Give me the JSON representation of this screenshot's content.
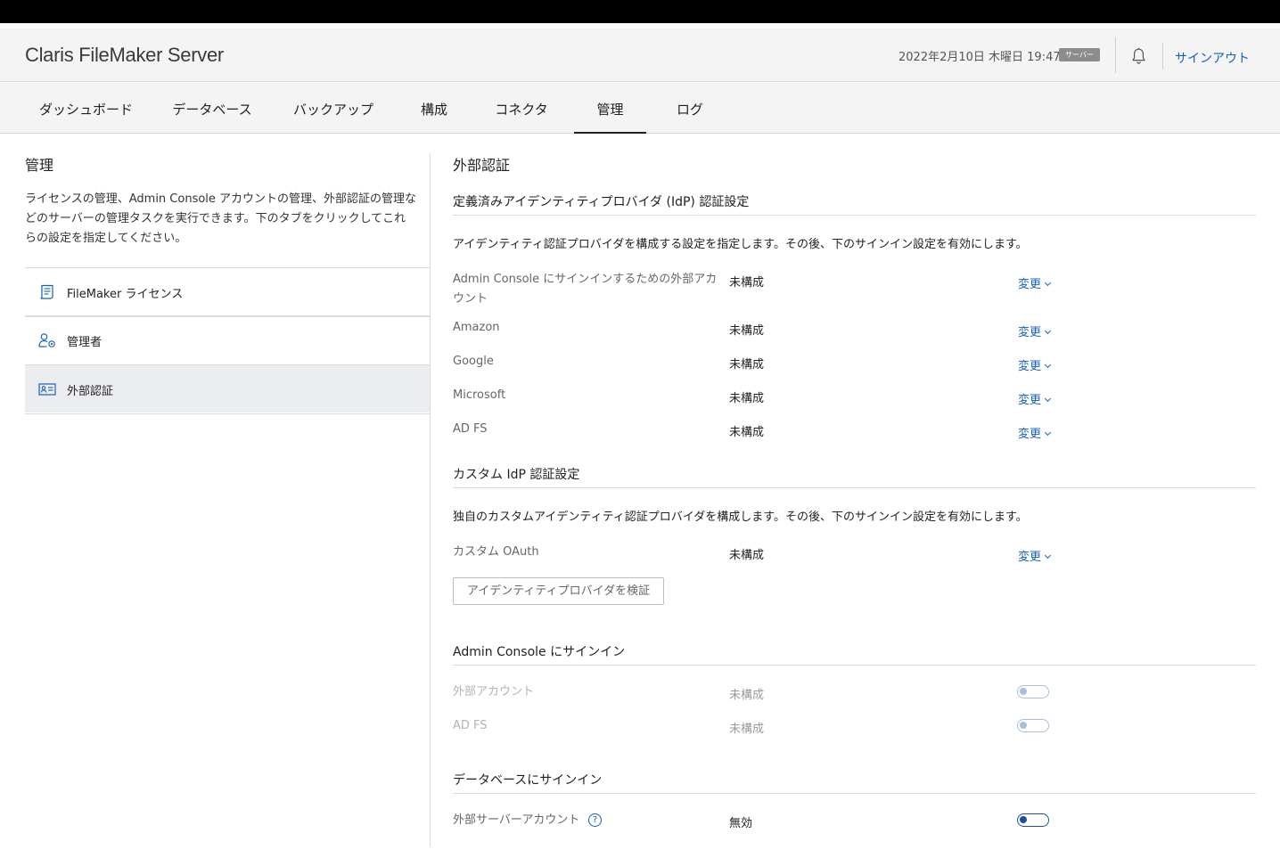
{
  "app": {
    "title": "Claris FileMaker Server"
  },
  "header": {
    "datetime": "2022年2月10日 木曜日 19:47",
    "server_badge": "サーバー",
    "bell_icon": "bell-icon",
    "signout": "サインアウト"
  },
  "nav": {
    "tabs": [
      {
        "label": "ダッシュボード"
      },
      {
        "label": "データベース"
      },
      {
        "label": "バックアップ"
      },
      {
        "label": "構成"
      },
      {
        "label": "コネクタ"
      },
      {
        "label": "管理",
        "active": true
      },
      {
        "label": "ログ"
      }
    ]
  },
  "left": {
    "title": "管理",
    "description": "ライセンスの管理、Admin Console アカウントの管理、外部認証の管理などのサーバーの管理タスクを実行できます。下のタブをクリックしてこれらの設定を指定してください。",
    "items": [
      {
        "label": "FileMaker ライセンス",
        "icon": "license-icon"
      },
      {
        "label": "管理者",
        "icon": "admin-user-icon"
      },
      {
        "label": "外部認証",
        "icon": "id-card-icon",
        "active": true
      }
    ]
  },
  "main": {
    "title": "外部認証",
    "idp_section": {
      "title": "定義済みアイデンティティプロバイダ (IdP) 認証設定",
      "description": "アイデンティティ認証プロバイダを構成する設定を指定します。その後、下のサインイン設定を有効にします。",
      "rows": [
        {
          "label": "Admin Console にサインインするための外部アカウント",
          "status": "未構成",
          "action": "変更"
        },
        {
          "label": "Amazon",
          "status": "未構成",
          "action": "変更"
        },
        {
          "label": "Google",
          "status": "未構成",
          "action": "変更"
        },
        {
          "label": "Microsoft",
          "status": "未構成",
          "action": "変更"
        },
        {
          "label": "AD FS",
          "status": "未構成",
          "action": "変更"
        }
      ]
    },
    "custom_section": {
      "title": "カスタム IdP 認証設定",
      "description": "独自のカスタムアイデンティティ認証プロバイダを構成します。その後、下のサインイン設定を有効にします。",
      "rows": [
        {
          "label": "カスタム OAuth",
          "status": "未構成",
          "action": "変更"
        }
      ],
      "verify_button": "アイデンティティプロバイダを検証"
    },
    "admin_signin_section": {
      "title": "Admin Console にサインイン",
      "rows": [
        {
          "label": "外部アカウント",
          "status": "未構成",
          "enabled": false,
          "disabled": true
        },
        {
          "label": "AD FS",
          "status": "未構成",
          "enabled": false,
          "disabled": true
        }
      ]
    },
    "db_signin_section": {
      "title": "データベースにサインイン",
      "rows": [
        {
          "label": "外部サーバーアカウント",
          "status": "無効",
          "enabled": false,
          "help_icon": "help-icon"
        }
      ]
    }
  },
  "colors": {
    "link": "#1760b8",
    "toggle": "#1b4f9c",
    "header_bg": "#f4f4f4",
    "active_item_bg": "#ecedf1"
  }
}
